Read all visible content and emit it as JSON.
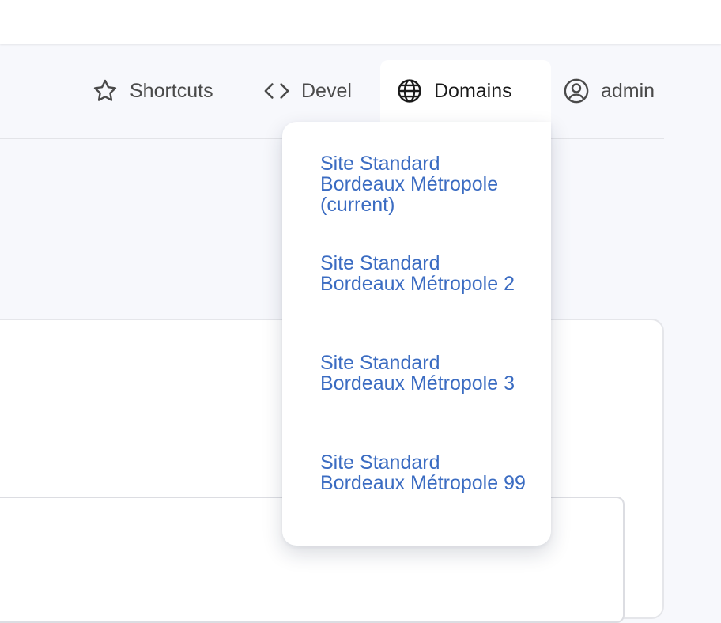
{
  "toolbar": {
    "shortcuts": {
      "label": "Shortcuts",
      "icon": "star-icon"
    },
    "devel": {
      "label": "Devel",
      "icon": "code-icon"
    },
    "domains": {
      "label": "Domains",
      "icon": "globe-icon"
    },
    "user": {
      "label": "admin",
      "icon": "user-circle-icon"
    }
  },
  "domains_menu": {
    "items": [
      {
        "label": "Site Standard Bordeaux Métropole (current)"
      },
      {
        "label": "Site Standard Bordeaux Métropole 2"
      },
      {
        "label": "Site Standard Bordeaux Métropole 3"
      },
      {
        "label": "Site Standard Bordeaux Métropole 99"
      }
    ],
    "link_color": "#3b6cc2"
  }
}
